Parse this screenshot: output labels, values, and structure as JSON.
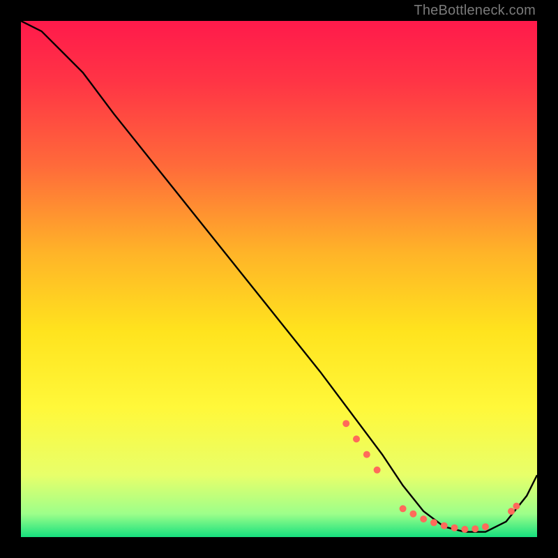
{
  "watermark": "TheBottleneck.com",
  "chart_data": {
    "type": "line",
    "title": "",
    "xlabel": "",
    "ylabel": "",
    "xlim": [
      0,
      100
    ],
    "ylim": [
      0,
      100
    ],
    "grid": false,
    "legend": false,
    "background_gradient": {
      "stops": [
        {
          "offset": 0.0,
          "color": "#ff1a4b"
        },
        {
          "offset": 0.12,
          "color": "#ff3545"
        },
        {
          "offset": 0.28,
          "color": "#ff6a3a"
        },
        {
          "offset": 0.45,
          "color": "#ffb428"
        },
        {
          "offset": 0.6,
          "color": "#ffe31e"
        },
        {
          "offset": 0.75,
          "color": "#fff83a"
        },
        {
          "offset": 0.88,
          "color": "#e8ff6a"
        },
        {
          "offset": 0.955,
          "color": "#9dff8a"
        },
        {
          "offset": 1.0,
          "color": "#16e07e"
        }
      ]
    },
    "series": [
      {
        "name": "curve",
        "color": "#000000",
        "x": [
          0,
          4,
          8,
          12,
          18,
          26,
          34,
          42,
          50,
          58,
          64,
          70,
          74,
          78,
          82,
          86,
          90,
          94,
          98,
          100
        ],
        "y": [
          100,
          98,
          94,
          90,
          82,
          72,
          62,
          52,
          42,
          32,
          24,
          16,
          10,
          5,
          2,
          1,
          1,
          3,
          8,
          12
        ]
      }
    ],
    "markers": {
      "name": "highlight-points",
      "color": "#ff6a5a",
      "radius": 5,
      "points": [
        {
          "x": 63,
          "y": 22
        },
        {
          "x": 65,
          "y": 19
        },
        {
          "x": 67,
          "y": 16
        },
        {
          "x": 69,
          "y": 13
        },
        {
          "x": 74,
          "y": 5.5
        },
        {
          "x": 76,
          "y": 4.5
        },
        {
          "x": 78,
          "y": 3.5
        },
        {
          "x": 80,
          "y": 2.8
        },
        {
          "x": 82,
          "y": 2.2
        },
        {
          "x": 84,
          "y": 1.8
        },
        {
          "x": 86,
          "y": 1.5
        },
        {
          "x": 88,
          "y": 1.6
        },
        {
          "x": 90,
          "y": 2.0
        },
        {
          "x": 95,
          "y": 5.0
        },
        {
          "x": 96,
          "y": 6.0
        }
      ]
    }
  }
}
